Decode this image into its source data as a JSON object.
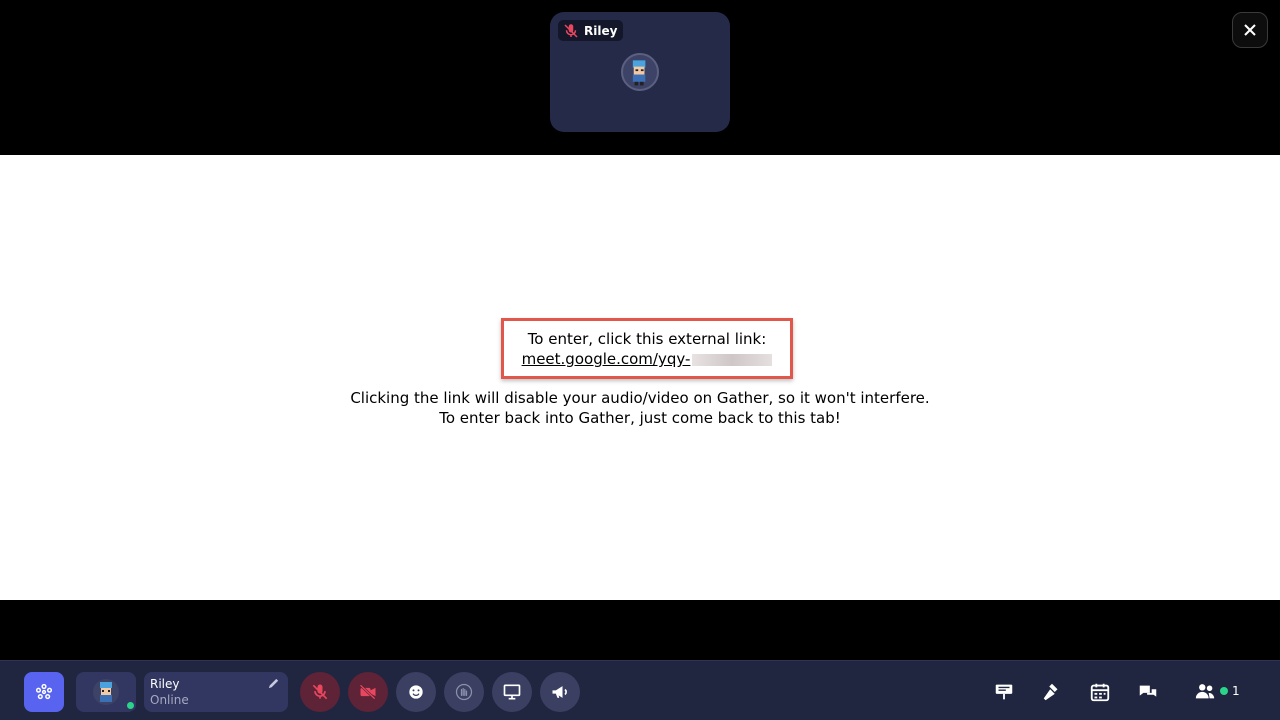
{
  "video_tile": {
    "participant_name": "Riley",
    "mic_muted": true
  },
  "close": {
    "icon": "close-icon"
  },
  "external_link": {
    "prompt": "To enter, click this external link:",
    "link_text": "meet.google.com/yqy-"
  },
  "info": {
    "line1": "Clicking the link will disable your audio/video on Gather, so it won't interfere.",
    "line2": "To enter back into Gather, just come back to this tab!"
  },
  "toolbar": {
    "user_name": "Riley",
    "user_status": "Online",
    "participant_count": "1",
    "colors": {
      "accent": "#5864f0",
      "online": "#2bd48b",
      "muted": "#e8475f"
    },
    "buttons": [
      "mic-off-icon",
      "camera-off-icon",
      "emoji-icon",
      "wave-hand-icon",
      "screen-share-icon",
      "megaphone-icon"
    ],
    "right_icons": [
      "sign-icon",
      "build-hammer-icon",
      "calendar-icon",
      "chat-icon",
      "people-icon"
    ]
  }
}
